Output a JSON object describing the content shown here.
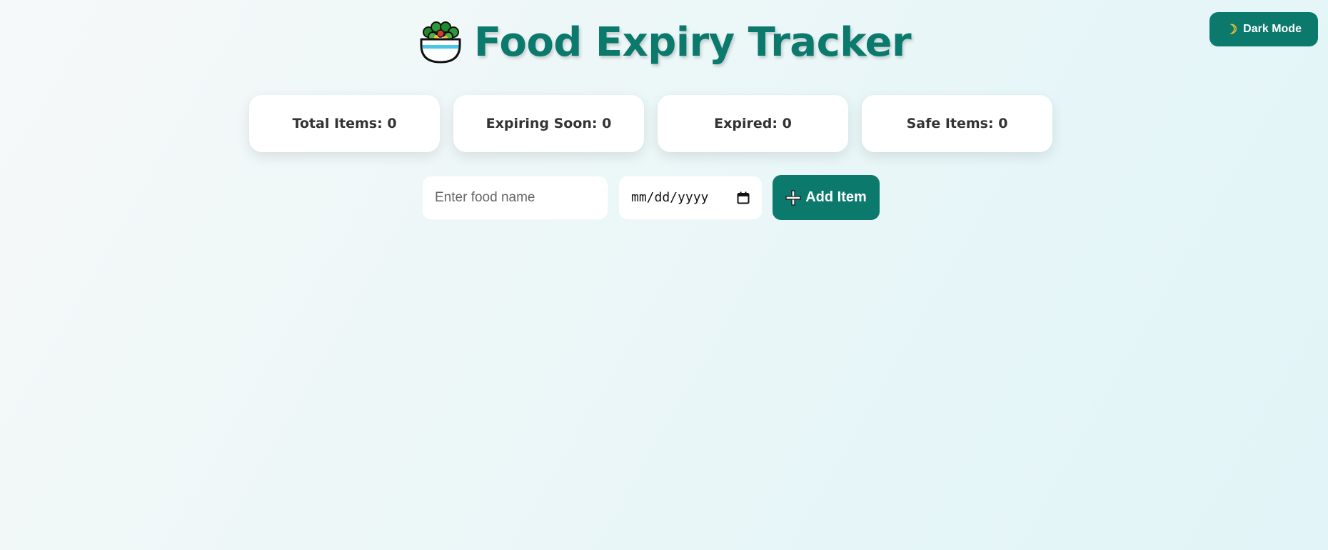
{
  "theme_toggle": {
    "icon": "moon-icon",
    "label": "Dark Mode"
  },
  "header": {
    "icon": "green-salad-icon",
    "title": "Food Expiry Tracker"
  },
  "stats": [
    {
      "label": "Total Items: 0"
    },
    {
      "label": "Expiring Soon: 0"
    },
    {
      "label": "Expired: 0"
    },
    {
      "label": "Safe Items: 0"
    }
  ],
  "form": {
    "food_name": {
      "value": "",
      "placeholder": "Enter food name"
    },
    "expiry_date": {
      "value": "",
      "placeholder": "mm/dd/yyyy"
    },
    "add_button": {
      "icon": "plus-icon",
      "label": "Add Item"
    }
  },
  "colors": {
    "accent": "#0b7a6d",
    "card_background": "#ffffff",
    "card_text": "#333333"
  }
}
